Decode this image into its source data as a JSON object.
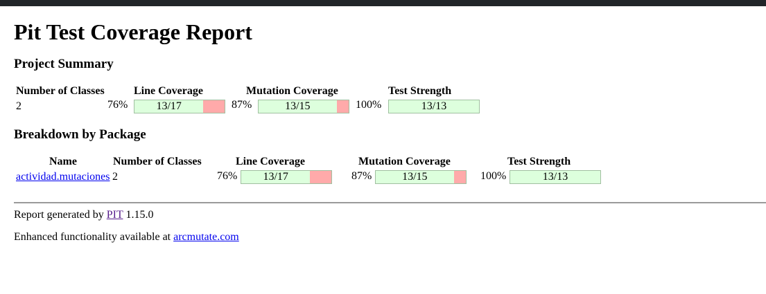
{
  "title": "Pit Test Coverage Report",
  "project_summary": {
    "heading": "Project Summary",
    "headers": {
      "classes": "Number of Classes",
      "line": "Line Coverage",
      "mutation": "Mutation Coverage",
      "strength": "Test Strength"
    },
    "num_classes": "2",
    "line": {
      "percent": "76%",
      "label": "13/17",
      "fraction": 0.7647
    },
    "mutation": {
      "percent": "87%",
      "label": "13/15",
      "fraction": 0.8667
    },
    "strength": {
      "percent": "100%",
      "label": "13/13",
      "fraction": 1.0
    }
  },
  "breakdown": {
    "heading": "Breakdown by Package",
    "headers": {
      "name": "Name",
      "classes": "Number of Classes",
      "line": "Line Coverage",
      "mutation": "Mutation Coverage",
      "strength": "Test Strength"
    },
    "rows": [
      {
        "name": "actividad.mutaciones",
        "num_classes": "2",
        "line": {
          "percent": "76%",
          "label": "13/17",
          "fraction": 0.7647
        },
        "mutation": {
          "percent": "87%",
          "label": "13/15",
          "fraction": 0.8667
        },
        "strength": {
          "percent": "100%",
          "label": "13/13",
          "fraction": 1.0
        }
      }
    ]
  },
  "footer": {
    "generated_prefix": "Report generated by",
    "pit_link": "PIT",
    "version": "1.15.0",
    "enhanced_prefix": "Enhanced functionality available at",
    "arcmutate_link": "arcmutate.com"
  },
  "colors": {
    "covered": "#ddffdd",
    "uncovered": "#ffaaaa",
    "topbar": "#212529"
  }
}
